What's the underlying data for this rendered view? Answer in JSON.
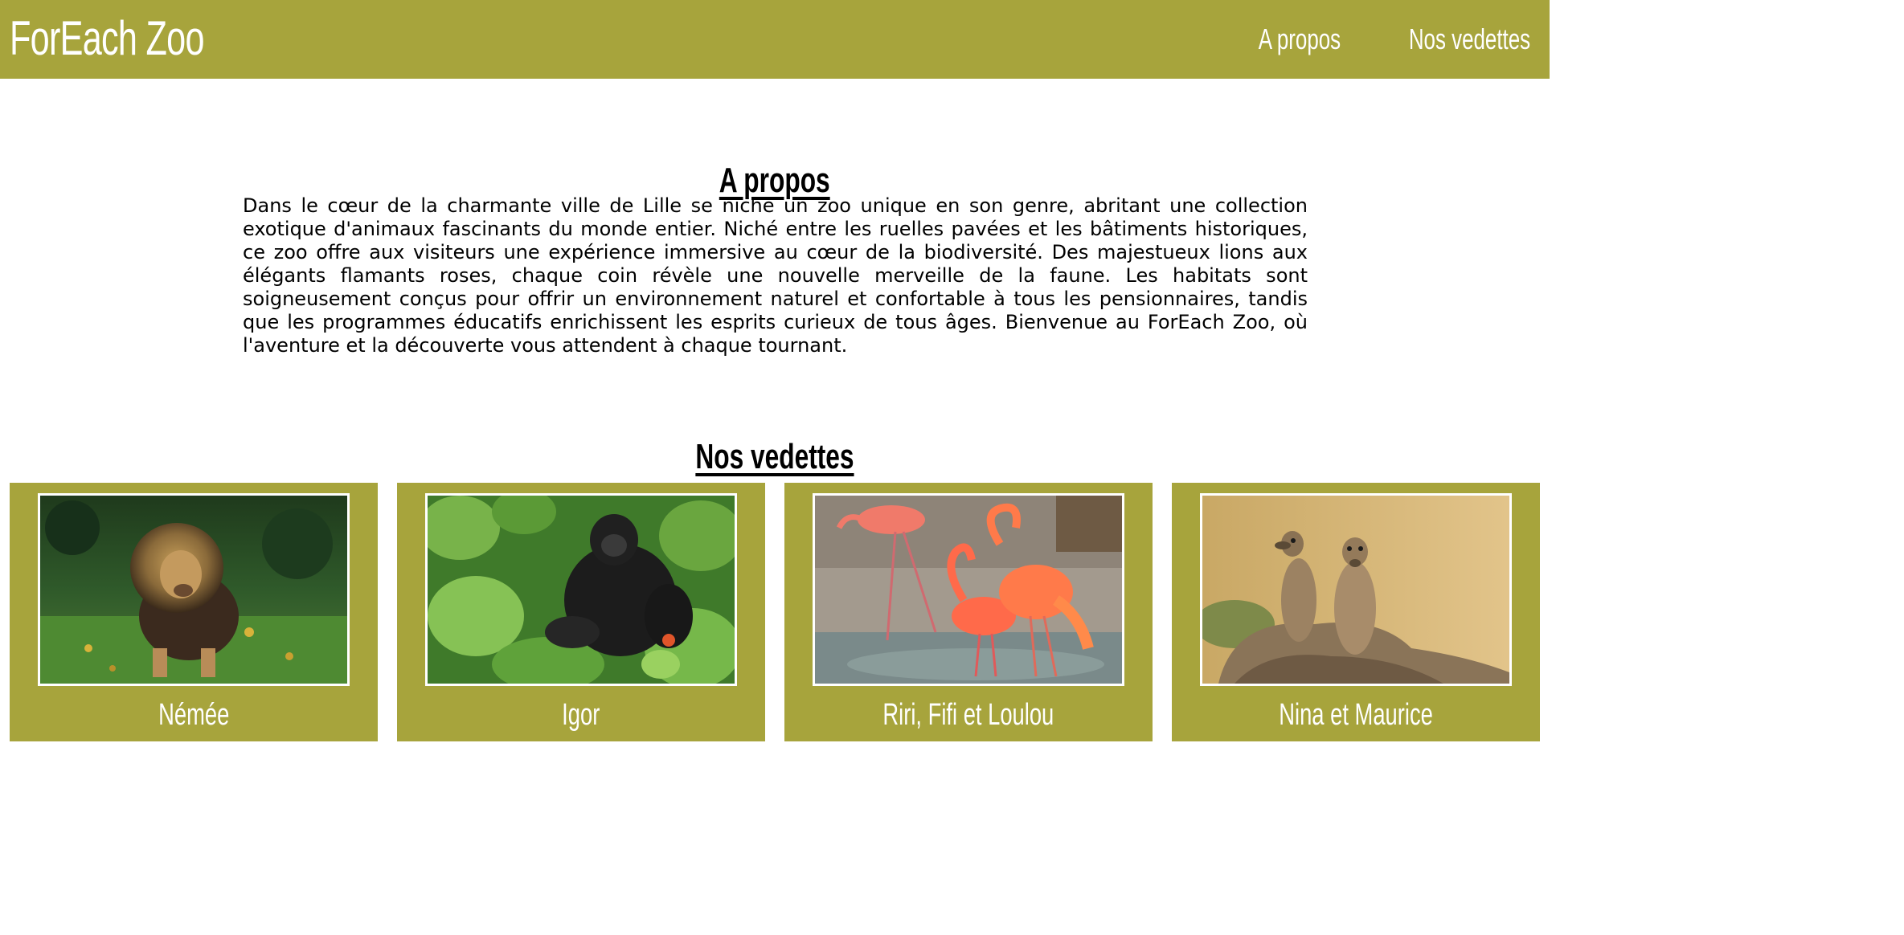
{
  "header": {
    "brand": "ForEach Zoo",
    "nav": [
      "A propos",
      "Nos vedettes"
    ]
  },
  "about": {
    "title": "A propos",
    "text": "Dans le cœur de la charmante ville de Lille se niche un zoo unique en son genre, abritant une collection exotique d'animaux fascinants du monde entier. Niché entre les ruelles pavées et les bâtiments historiques, ce zoo offre aux visiteurs une expérience immersive au cœur de la biodiversité. Des majestueux lions aux élégants flamants roses, chaque coin révèle une nouvelle merveille de la faune. Les habitats sont soigneusement conçus pour offrir un environnement naturel et confortable à tous les pensionnaires, tandis que les programmes éducatifs enrichissent les esprits curieux de tous âges. Bienvenue au ForEach Zoo, où l'aventure et la découverte vous attendent à chaque tournant."
  },
  "stars": {
    "title": "Nos vedettes",
    "cards": [
      {
        "name": "Némée",
        "photo": "lion-photo"
      },
      {
        "name": "Igor",
        "photo": "gorilla-photo"
      },
      {
        "name": "Riri, Fifi et Loulou",
        "photo": "flamingos-photo"
      },
      {
        "name": "Nina et Maurice",
        "photo": "meerkats-photo"
      }
    ]
  },
  "colors": {
    "accent": "#a7a43c",
    "text": "#000000",
    "on_accent": "#ffffff"
  }
}
